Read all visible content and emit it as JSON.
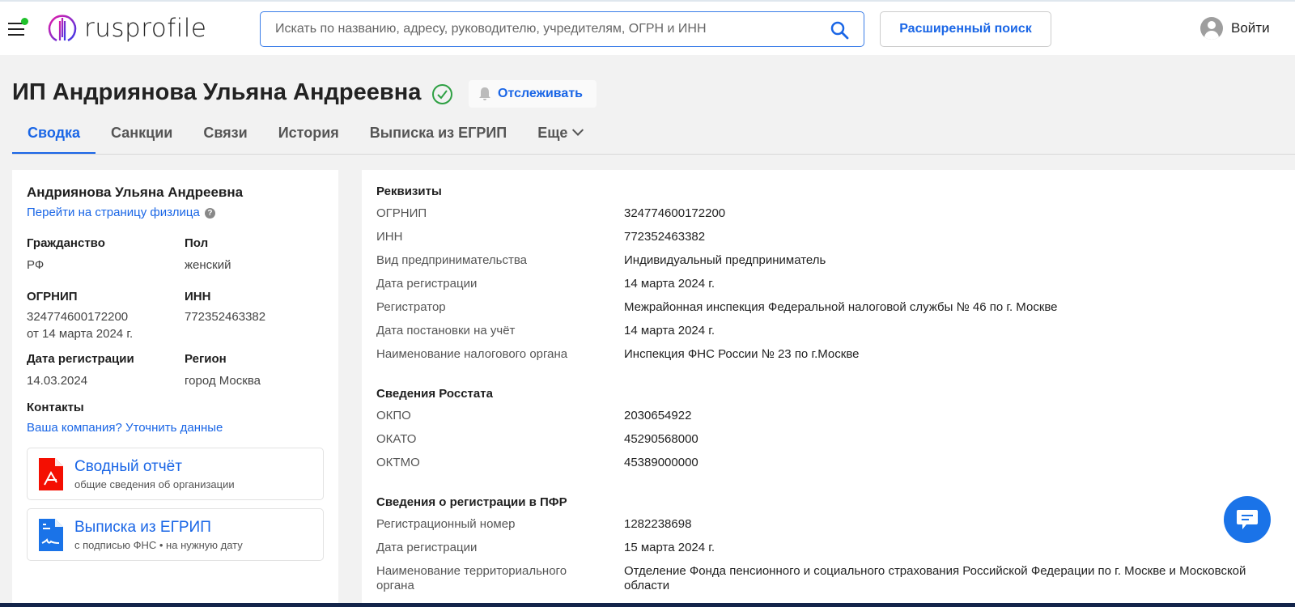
{
  "header": {
    "logo_text": "rusprofile",
    "search_placeholder": "Искать по названию, адресу, руководителю, учредителям, ОГРН и ИНН",
    "advanced_search": "Расширенный поиск",
    "login": "Войти",
    "status_dot_color": "#1fc12b"
  },
  "page": {
    "title": "ИП Андриянова Ульяна Андреевна",
    "track_label": "Отслеживать"
  },
  "tabs": [
    {
      "label": "Сводка",
      "active": true
    },
    {
      "label": "Санкции"
    },
    {
      "label": "Связи"
    },
    {
      "label": "История"
    },
    {
      "label": "Выписка из ЕГРИП"
    },
    {
      "label": "Еще"
    }
  ],
  "left": {
    "name": "Андриянова Ульяна Андреевна",
    "person_link": "Перейти на страницу физлица",
    "citizenship_label": "Гражданство",
    "citizenship": "РФ",
    "gender_label": "Пол",
    "gender": "женский",
    "ogrnip_label": "ОГРНИП",
    "ogrnip": "324774600172200",
    "ogrnip_date": "от 14 марта 2024 г.",
    "inn_label": "ИНН",
    "inn": "772352463382",
    "reg_date_label": "Дата регистрации",
    "reg_date": "14.03.2024",
    "region_label": "Регион",
    "region": "город Москва",
    "contacts_label": "Контакты",
    "contacts_link": "Ваша компания? Уточнить данные",
    "cards": [
      {
        "title": "Сводный отчёт",
        "subtitle": "общие сведения об организации",
        "icon": "pdf-icon"
      },
      {
        "title": "Выписка из ЕГРИП",
        "subtitle": "с подписью ФНС • на нужную дату",
        "icon": "signed-document-icon"
      }
    ]
  },
  "right": {
    "sections": [
      {
        "title": "Реквизиты",
        "rows": [
          [
            "ОГРНИП",
            "324774600172200"
          ],
          [
            "ИНН",
            "772352463382"
          ],
          [
            "Вид предпринимательства",
            "Индивидуальный предприниматель"
          ],
          [
            "Дата регистрации",
            "14 марта 2024 г."
          ],
          [
            "Регистратор",
            "Межрайонная инспекция Федеральной налоговой службы № 46 по г. Москве"
          ],
          [
            "Дата постановки на учёт",
            "14 марта 2024 г."
          ],
          [
            "Наименование налогового органа",
            "Инспекция ФНС России № 23 по г.Москве"
          ]
        ]
      },
      {
        "title": "Сведения Росстата",
        "rows": [
          [
            "ОКПО",
            "2030654922"
          ],
          [
            "ОКАТО",
            "45290568000"
          ],
          [
            "ОКТМО",
            "45389000000"
          ]
        ]
      },
      {
        "title": "Сведения о регистрации в ПФР",
        "rows": [
          [
            "Регистрационный номер",
            "1282238698"
          ],
          [
            "Дата регистрации",
            "15 марта 2024 г."
          ],
          [
            "Наименование территориального органа",
            "Отделение Фонда пенсионного и социального страхования Российской Федерации по г. Москве и Московской области"
          ]
        ]
      }
    ]
  },
  "colors": {
    "accent": "#1a66e6",
    "verified": "#2ea043",
    "pdf": "#f40f02"
  }
}
